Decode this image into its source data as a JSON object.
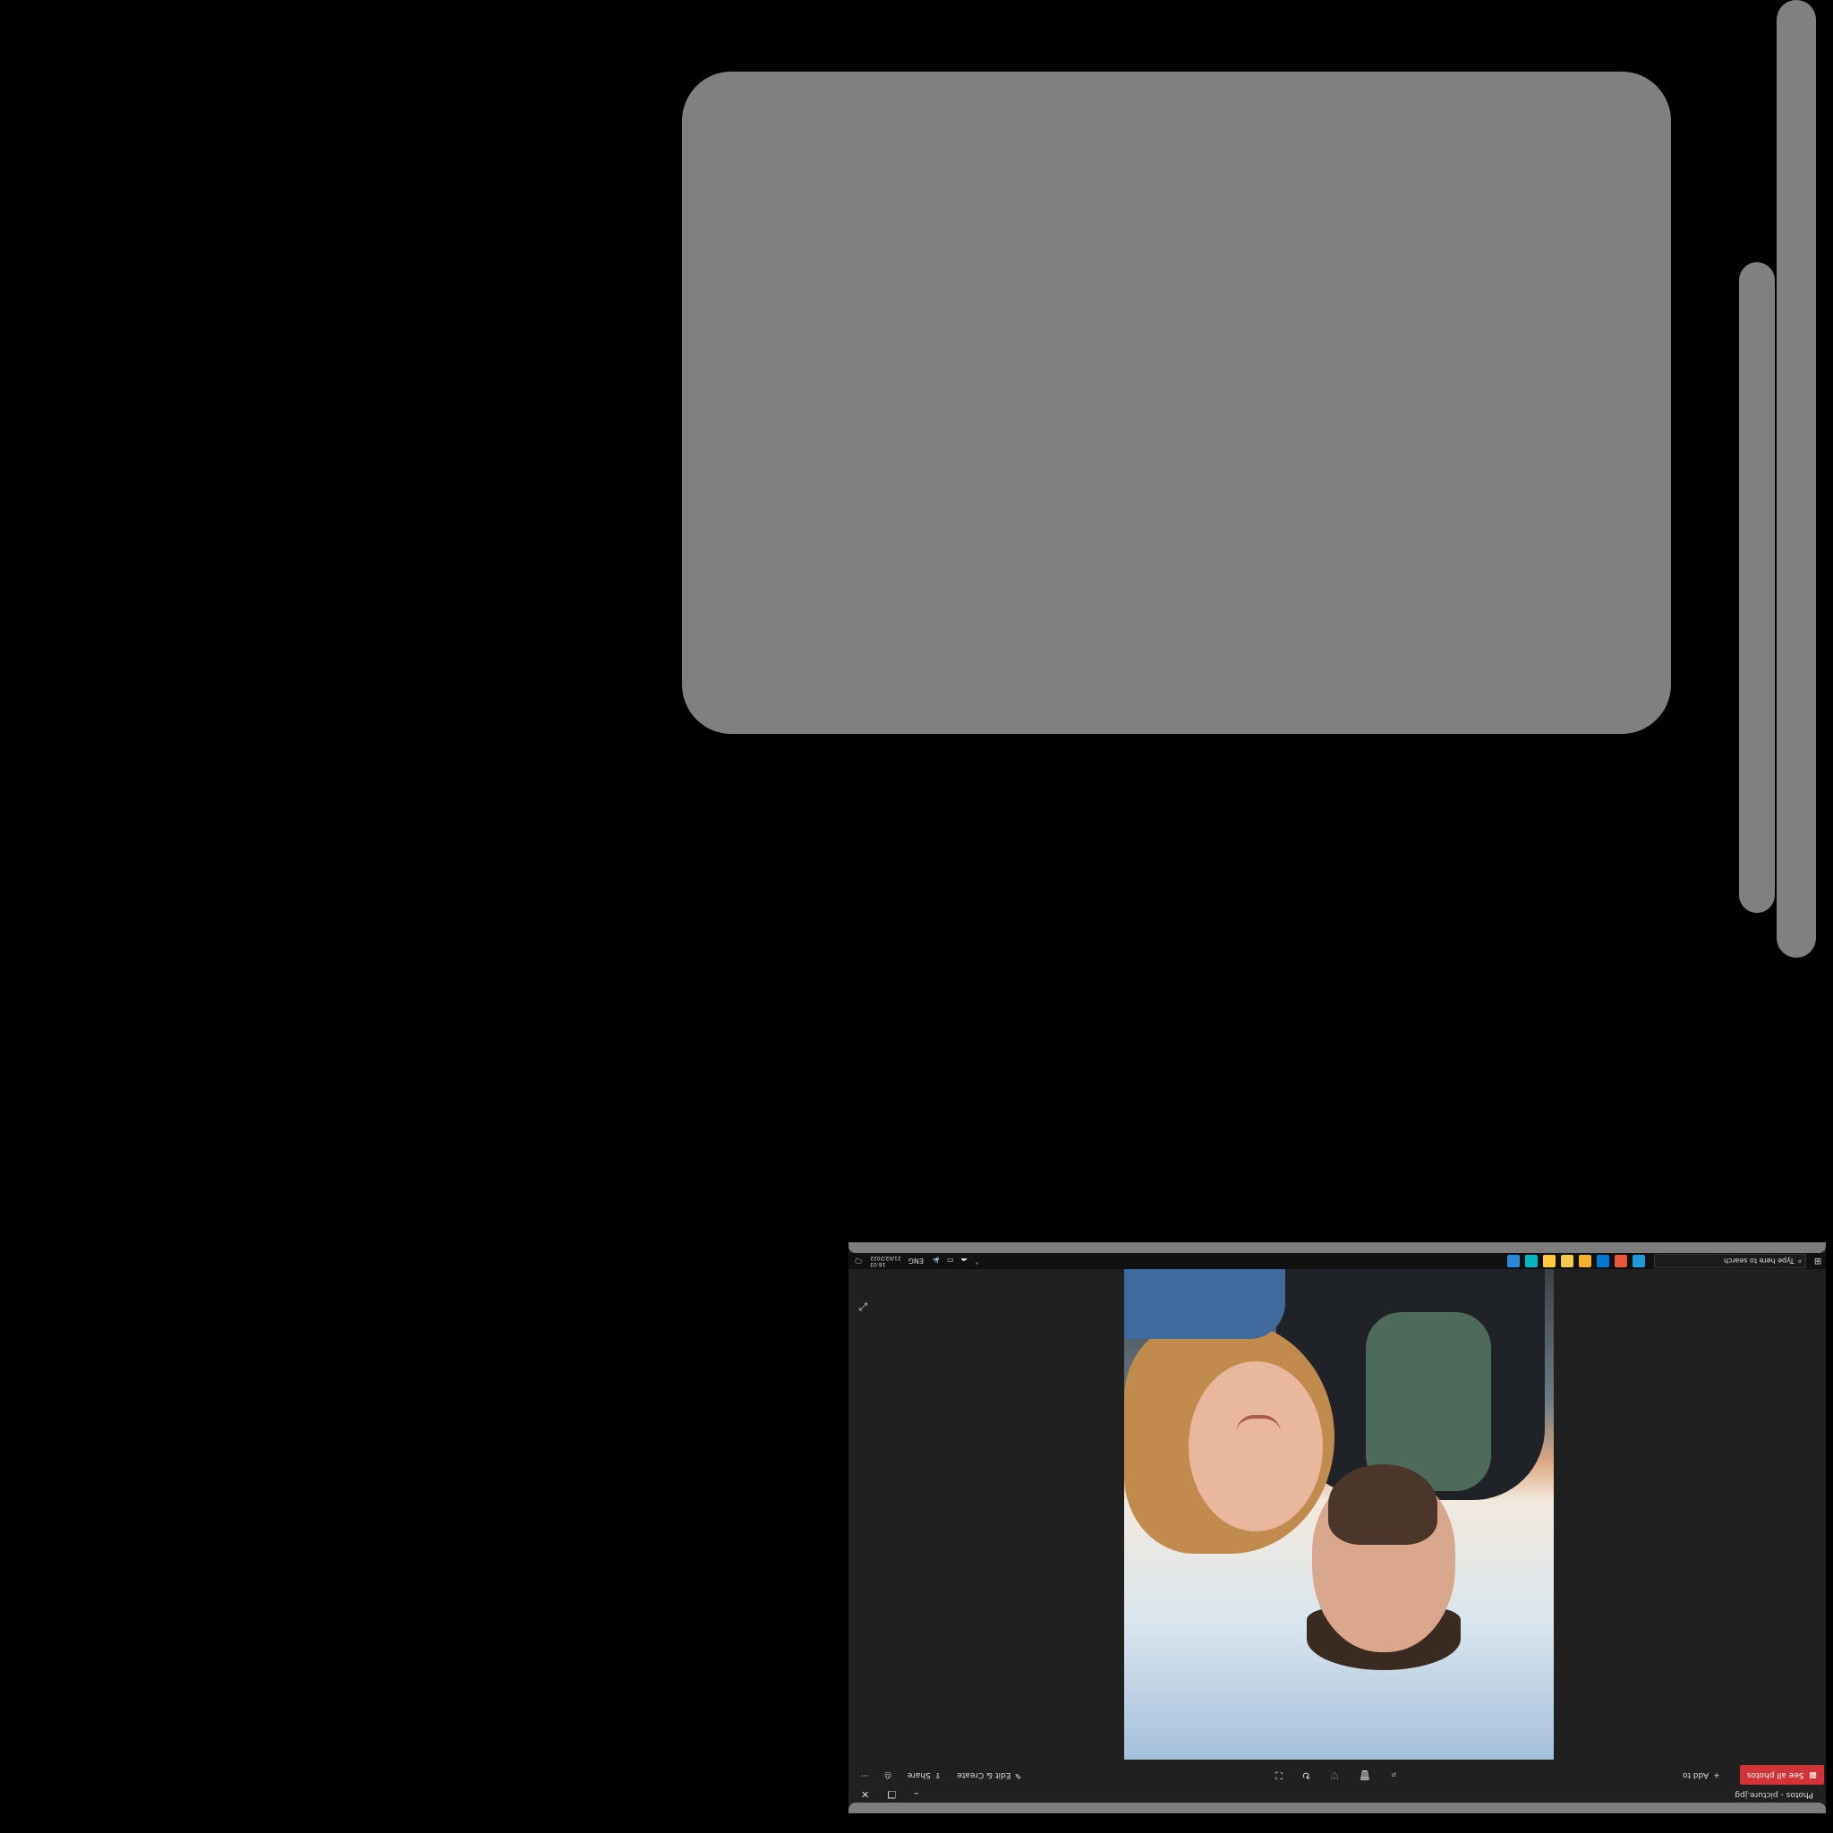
{
  "window": {
    "title": "Photos - picture.jpg",
    "minimize": "–",
    "restore": "❐",
    "close": "✕"
  },
  "toolbar": {
    "see_all_photos": "See all photos",
    "add_to": "Add to",
    "edit_create": "Edit & Create",
    "share": "Share",
    "more": "···"
  },
  "taskbar": {
    "search_placeholder": "Type here to search",
    "language": "ENG",
    "time": "16:03",
    "date": "21/02/2022"
  },
  "colors": {
    "accent": "#d13438",
    "app_bg": "#202020",
    "taskbar": "#111111"
  }
}
